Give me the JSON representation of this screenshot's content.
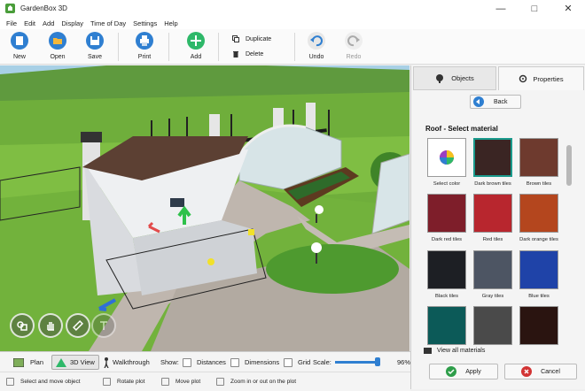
{
  "window": {
    "title": "GardenBox 3D"
  },
  "menu": {
    "items": [
      "File",
      "Edit",
      "Add",
      "Display",
      "Time of Day",
      "Settings",
      "Help"
    ]
  },
  "toolbar": {
    "new": "New",
    "open": "Open",
    "save": "Save",
    "print": "Print",
    "add": "Add",
    "duplicate": "Duplicate",
    "delete": "Delete",
    "undo": "Undo",
    "redo": "Redo"
  },
  "panel": {
    "tab_objects": "Objects",
    "tab_properties": "Properties",
    "back": "Back",
    "section_title": "Roof - Select material",
    "materials": [
      {
        "name": "Select color",
        "color": "#ffffff"
      },
      {
        "name": "Dark brown tiles",
        "color": "#3a2523"
      },
      {
        "name": "Brown tiles",
        "color": "#6e3a2e"
      },
      {
        "name": "Dark red tiles",
        "color": "#7e1e2a"
      },
      {
        "name": "Red tiles",
        "color": "#b8262e"
      },
      {
        "name": "Dark orange tiles",
        "color": "#b4461e"
      },
      {
        "name": "Black tiles",
        "color": "#1d1f24"
      },
      {
        "name": "Gray tiles",
        "color": "#4d5563"
      },
      {
        "name": "Blue tiles",
        "color": "#1f43a8"
      },
      {
        "name": "",
        "color": "#0c5a58"
      },
      {
        "name": "",
        "color": "#4a4a4a"
      },
      {
        "name": "",
        "color": "#2a1410"
      }
    ],
    "selected_material": "Dark brown tiles",
    "view_all": "View all materials",
    "apply": "Apply",
    "cancel": "Cancel"
  },
  "viewbar": {
    "plan": "Plan",
    "view3d": "3D View",
    "walkthrough": "Walkthrough",
    "show": "Show:",
    "distances": "Distances",
    "dimensions": "Dimensions",
    "grid": "Grid",
    "scale": "Scale:",
    "scale_value": "96%",
    "scale_level": 0.96
  },
  "status": {
    "select": "Select and move object",
    "rotate": "Rotate plot",
    "move": "Move plot",
    "zoom": "Zoom in or out on the plot"
  },
  "colors": {
    "accent_green": "#2eb869",
    "accent_blue": "#2f7fd1",
    "apply_green": "#2e9e4a",
    "cancel_red": "#d23434"
  }
}
